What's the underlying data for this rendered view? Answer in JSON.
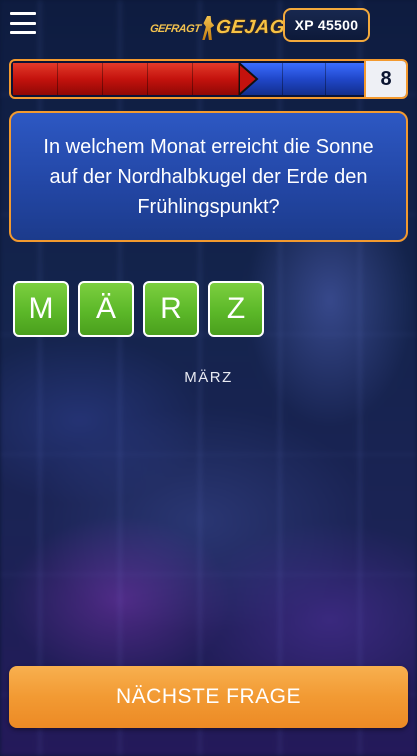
{
  "header": {
    "logo_small": "GEFRAGT",
    "logo_big": "GEJAGT",
    "xp_label": "XP 45500"
  },
  "chase": {
    "red_segments": 5,
    "blue_segments": 3,
    "count": "8"
  },
  "question": {
    "text": "In welchem Monat erreicht die Sonne auf der Nordhalbkugel der Erde den Frühlingspunkt?"
  },
  "answer": {
    "tiles": [
      "M",
      "Ä",
      "R",
      "Z"
    ],
    "label": "MÄRZ"
  },
  "next_button": {
    "label": "NÄCHSTE FRAGE"
  },
  "colors": {
    "accent_orange": "#f39a2f",
    "question_blue": "#2347a6",
    "tile_green": "#5cb829",
    "chase_red": "#c4120d",
    "chase_blue": "#2047c9"
  }
}
